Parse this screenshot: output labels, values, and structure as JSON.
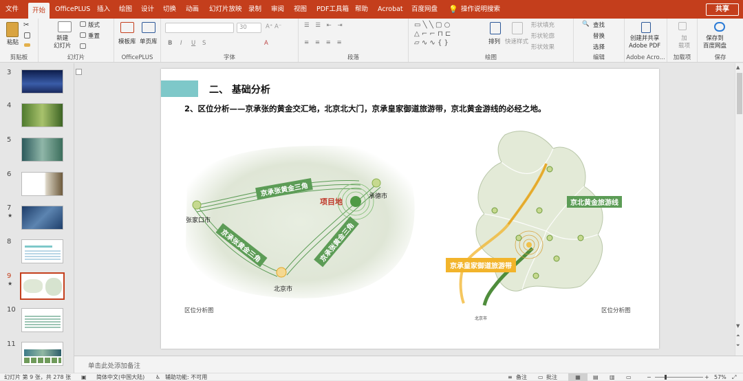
{
  "tabs": [
    "文件",
    "开始",
    "OfficePLUS",
    "插入",
    "绘图",
    "设计",
    "切换",
    "动画",
    "幻灯片放映",
    "录制",
    "审阅",
    "视图",
    "PDF工具箱",
    "帮助",
    "Acrobat",
    "百度网盘"
  ],
  "tell_me": "操作说明搜索",
  "share": "共享",
  "ribbon": {
    "clipboard": {
      "paste": "粘贴",
      "label": "剪贴板"
    },
    "slides": {
      "new": "新建\n幻灯片",
      "layout": "版式",
      "reset": "重置",
      "label": "幻灯片"
    },
    "officeplus": {
      "template": "模板库",
      "single": "单页库",
      "label": "OfficePLUS"
    },
    "font": {
      "size": "30",
      "label": "字体"
    },
    "paragraph": {
      "label": "段落"
    },
    "drawing": {
      "arrange": "排列",
      "quick_styles": "快速样式",
      "fill": "形状填充",
      "outline": "形状轮廓",
      "effects": "形状效果",
      "label": "绘图"
    },
    "editing": {
      "find": "查找",
      "replace": "替换",
      "select": "选择",
      "label": "编辑"
    },
    "adobe": {
      "create": "创建并共享\nAdobe PDF",
      "label": "Adobe Acro..."
    },
    "addins": {
      "add": "加\n载项",
      "label": "加载项"
    },
    "save": {
      "save": "保存到\n百度网盘",
      "label": "保存"
    }
  },
  "thumbnails": [
    {
      "num": "3",
      "star": ""
    },
    {
      "num": "4",
      "star": ""
    },
    {
      "num": "5",
      "star": ""
    },
    {
      "num": "6",
      "star": ""
    },
    {
      "num": "7",
      "star": "★"
    },
    {
      "num": "8",
      "star": ""
    },
    {
      "num": "9",
      "star": "★"
    },
    {
      "num": "10",
      "star": ""
    },
    {
      "num": "11",
      "star": ""
    }
  ],
  "slide": {
    "section_title": "二、 基础分析",
    "subtitle": "2、区位分析——京承张的黄金交汇地，北京北大门，京承皇家御道旅游带，京北黄金游线的必经之地。",
    "left_map": {
      "label_top": "京承张黄金三角",
      "label_left": "京承张黄金三角",
      "label_right": "京承张黄金三角",
      "project": "项目地",
      "city_zjk": "张家口市",
      "city_cd": "承德市",
      "city_bj": "北京市",
      "caption": "区位分析图"
    },
    "right_map": {
      "golden_line": "京北黄金旅游线",
      "royal_road": "京承皇家御道旅游带",
      "beijing": "北京市",
      "caption": "区位分析图"
    }
  },
  "notes": "单击此处添加备注",
  "status": {
    "slide_info": "幻灯片 第 9 张，共 278 张",
    "language": "简体中文(中国大陆)",
    "accessibility": "辅助功能: 不可用",
    "notes_btn": "备注",
    "comments_btn": "批注",
    "zoom": "57%"
  },
  "colors": {
    "accent": "#c43e1c",
    "green": "#5c9c56",
    "gold": "#f2b42b",
    "teal": "#7ec8c9"
  }
}
